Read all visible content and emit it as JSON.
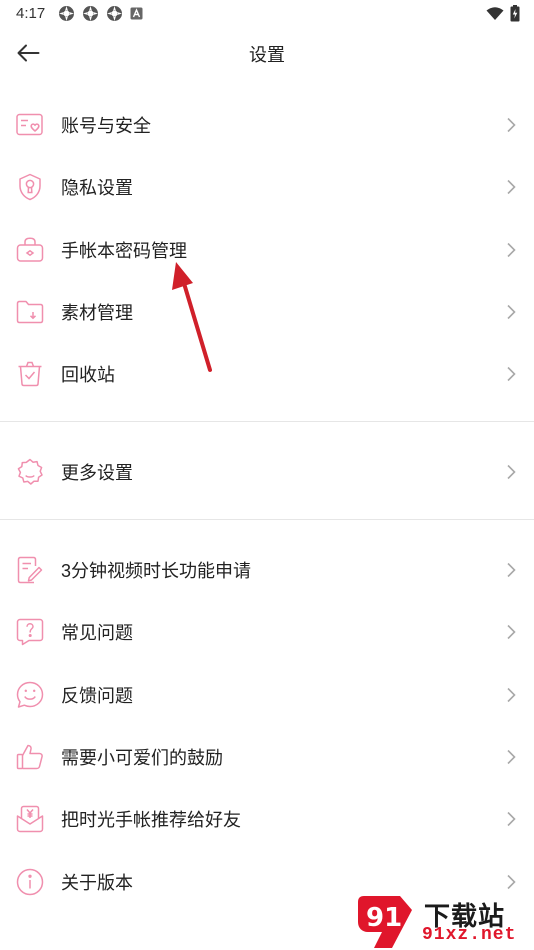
{
  "status_bar": {
    "time": "4:17"
  },
  "header": {
    "title": "设置"
  },
  "groups": [
    {
      "items": [
        {
          "label": "账号与安全",
          "icon": "account-icon"
        },
        {
          "label": "隐私设置",
          "icon": "privacy-shield-icon"
        },
        {
          "label": "手帐本密码管理",
          "icon": "lock-briefcase-icon"
        },
        {
          "label": "素材管理",
          "icon": "folder-icon"
        },
        {
          "label": "回收站",
          "icon": "trash-icon"
        }
      ]
    },
    {
      "items": [
        {
          "label": "更多设置",
          "icon": "gear-icon"
        }
      ]
    },
    {
      "items": [
        {
          "label": "3分钟视频时长功能申请",
          "icon": "edit-document-icon"
        },
        {
          "label": "常见问题",
          "icon": "question-icon"
        },
        {
          "label": "反馈问题",
          "icon": "smile-icon"
        },
        {
          "label": "需要小可爱们的鼓励",
          "icon": "thumbs-up-icon"
        },
        {
          "label": "把时光手帐推荐给好友",
          "icon": "yen-envelope-icon"
        },
        {
          "label": "关于版本",
          "icon": "info-icon"
        }
      ]
    }
  ],
  "watermark": {
    "line1": "下载站",
    "line2": "91xz.net",
    "badge": "91"
  },
  "colors": {
    "accent": "#f08fae",
    "annotation_arrow": "#d0202a",
    "watermark_red": "#e0162b"
  }
}
